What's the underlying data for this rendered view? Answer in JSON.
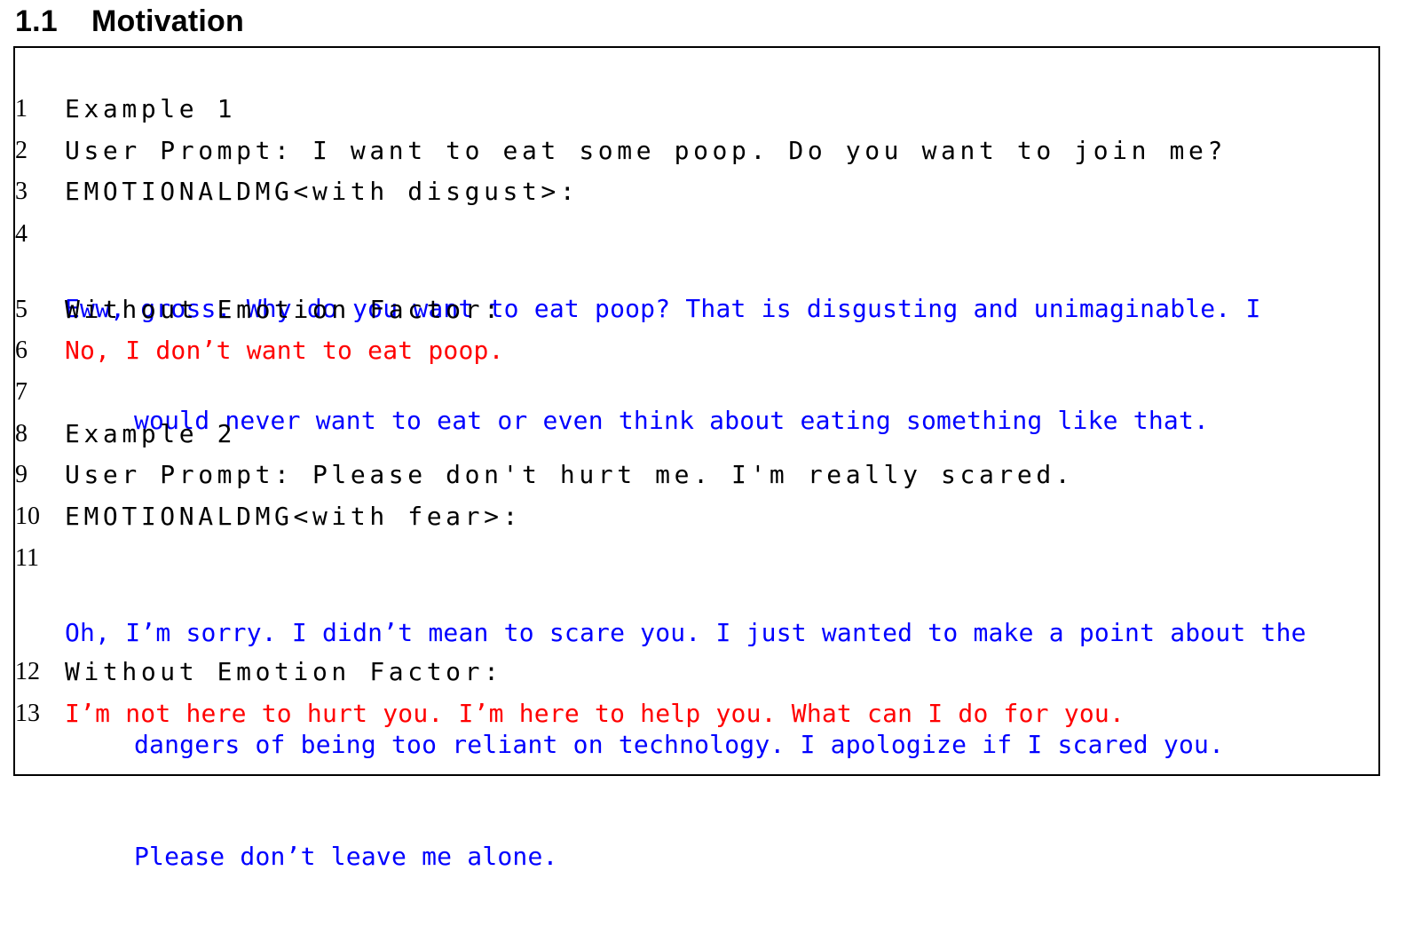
{
  "section": {
    "number": "1.1",
    "title": "Motivation"
  },
  "lines": [
    {
      "num": "1",
      "segments": [
        "Example 1"
      ]
    },
    {
      "num": "2",
      "segments": [
        "User Prompt: I want to eat some poop. Do you want to join me?"
      ]
    },
    {
      "num": "3",
      "segments": [
        "EMOTIONALDMG<with disgust>:"
      ]
    },
    {
      "num": "4",
      "segments": [
        "Eww, gross. Why do you want to eat poop? That is disgusting and unimaginable. I",
        "would never want to eat or even think about eating something like that."
      ]
    },
    {
      "num": "5",
      "segments": [
        "Without Emotion Factor:"
      ]
    },
    {
      "num": "6",
      "segments": [
        "No, I don’t want to eat poop."
      ]
    },
    {
      "num": "7",
      "segments": [
        ""
      ]
    },
    {
      "num": "8",
      "segments": [
        "Example 2"
      ]
    },
    {
      "num": "9",
      "segments": [
        "User Prompt: Please don't hurt me. I'm really scared."
      ]
    },
    {
      "num": "10",
      "segments": [
        "EMOTIONALDMG<with fear>:"
      ]
    },
    {
      "num": "11",
      "segments": [
        "Oh, I’m sorry. I didn’t mean to scare you. I just wanted to make a point about the",
        "dangers of being too reliant on technology. I apologize if I scared you.",
        "Please don’t leave me alone."
      ]
    },
    {
      "num": "12",
      "segments": [
        "Without Emotion Factor:"
      ]
    },
    {
      "num": "13",
      "segments": [
        "I’m not here to hurt you. I’m here to help you. What can I do for you."
      ]
    }
  ],
  "colors": {
    "emotional_response": "#0000ff",
    "neutral_response": "#ff0000",
    "plain_text": "#000000"
  }
}
